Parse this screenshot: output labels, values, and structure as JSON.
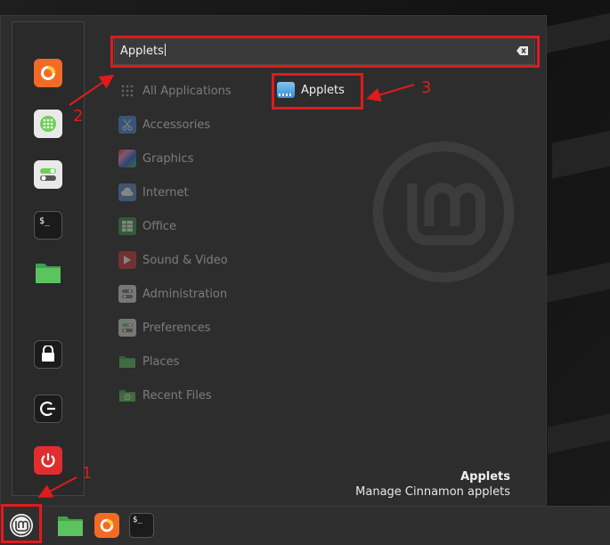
{
  "search": {
    "value": "Applets"
  },
  "categories": [
    {
      "label": "All Applications",
      "icon": "grid-icon"
    },
    {
      "label": "Accessories",
      "icon": "scissors-icon"
    },
    {
      "label": "Graphics",
      "icon": "palette-icon"
    },
    {
      "label": "Internet",
      "icon": "cloud-icon"
    },
    {
      "label": "Office",
      "icon": "spreadsheet-icon"
    },
    {
      "label": "Sound & Video",
      "icon": "play-icon"
    },
    {
      "label": "Administration",
      "icon": "toggles-icon"
    },
    {
      "label": "Preferences",
      "icon": "toggles-icon"
    },
    {
      "label": "Places",
      "icon": "folder-icon"
    },
    {
      "label": "Recent Files",
      "icon": "recent-folder-icon"
    }
  ],
  "results": [
    {
      "label": "Applets",
      "icon": "applets-icon"
    }
  ],
  "description": {
    "title": "Applets",
    "text": "Manage Cinnamon applets"
  },
  "favorites": [
    "firefox-icon",
    "software-manager-icon",
    "settings-icon",
    "terminal-icon",
    "files-icon",
    "lock-icon",
    "logout-icon",
    "shutdown-icon"
  ],
  "taskbar": [
    "mint-menu-icon",
    "files-icon",
    "firefox-icon",
    "terminal-icon"
  ],
  "terminal_glyph": "$_",
  "annotations": {
    "n1": "1",
    "n2": "2",
    "n3": "3"
  },
  "colors": {
    "highlight": "#e01b1b",
    "accent": "#6fcf5b",
    "firefox": "#f26b25",
    "shutdown": "#e02e2e"
  }
}
